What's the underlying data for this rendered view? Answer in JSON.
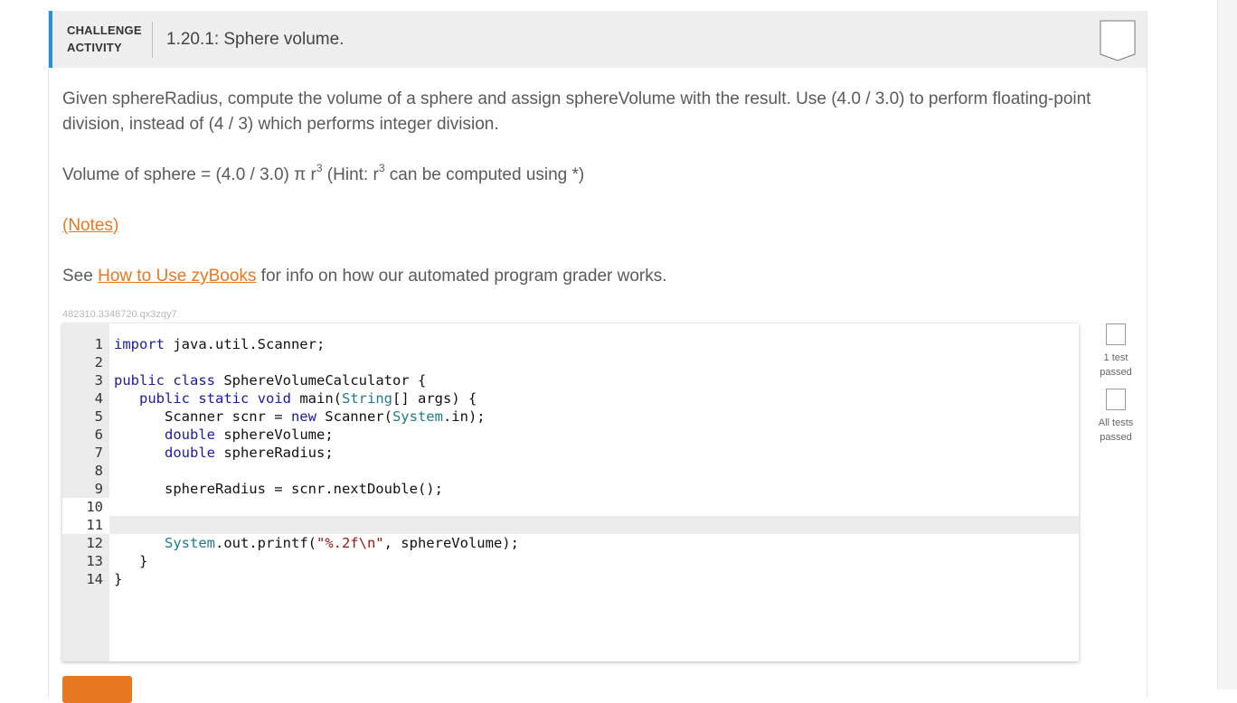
{
  "header": {
    "tag_line1": "CHALLENGE",
    "tag_line2": "ACTIVITY",
    "title": "1.20.1: Sphere volume."
  },
  "prompt": {
    "para1": "Given sphereRadius, compute the volume of a sphere and assign sphereVolume with the result. Use (4.0 / 3.0) to perform floating-point division, instead of (4 / 3) which performs integer division.",
    "formula_prefix": "Volume of sphere = (4.0 / 3.0) π r",
    "formula_exp1": "3",
    "formula_mid": " (Hint: r",
    "formula_exp2": "3",
    "formula_suffix": " can be computed using *)",
    "notes_link": "(Notes)",
    "see_prefix": "See ",
    "see_link": "How to Use zyBooks",
    "see_suffix": " for info on how our automated program grader works."
  },
  "code_id": "482310.3348720.qx3zqy7",
  "editor": {
    "line_numbers": [
      "1",
      "2",
      "3",
      "4",
      "5",
      "6",
      "7",
      "8",
      "9",
      "10",
      "11",
      "12",
      "13",
      "14"
    ],
    "active_line": "11"
  },
  "status": {
    "test1_label_a": "1 test",
    "test1_label_b": "passed",
    "test2_label_a": "All tests",
    "test2_label_b": "passed"
  },
  "colors": {
    "accent_orange": "#e87722",
    "header_accent_blue": "#2b8fd6",
    "keyword_blue": "#1a1aa6",
    "type_teal": "#1f7a8c"
  }
}
